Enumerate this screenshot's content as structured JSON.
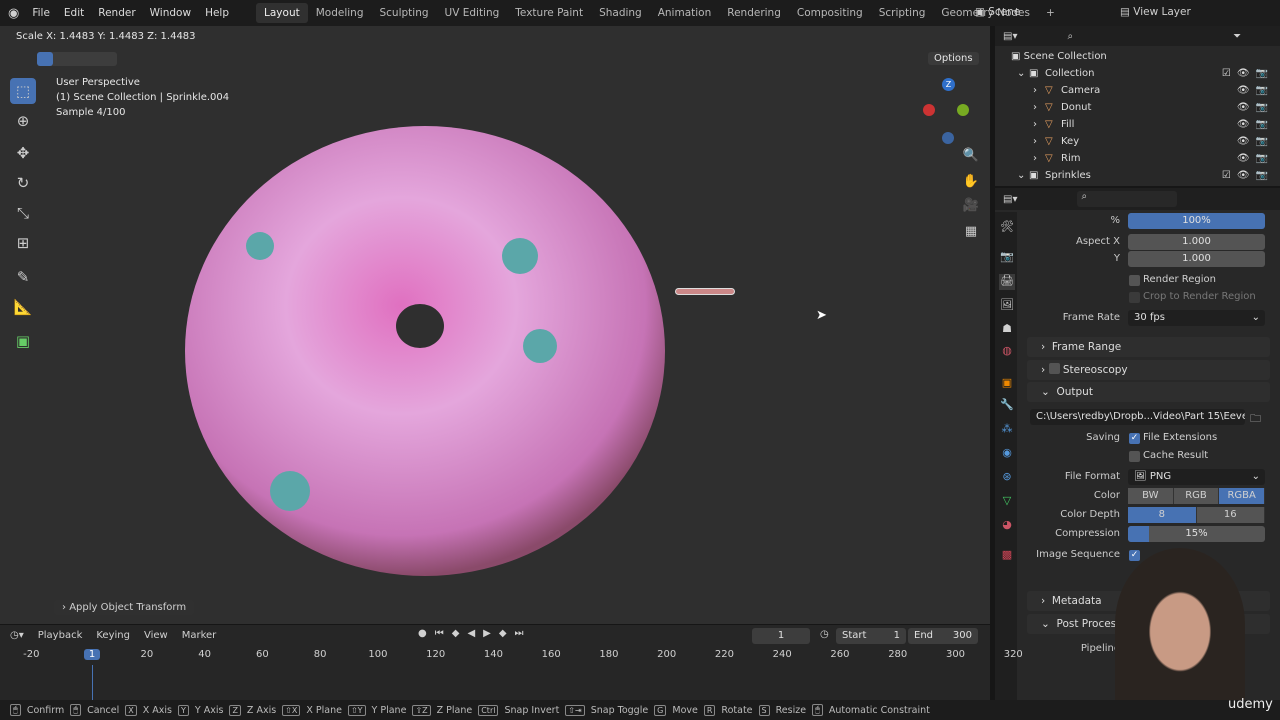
{
  "topbar": {
    "menus": [
      "File",
      "Edit",
      "Render",
      "Window",
      "Help"
    ],
    "workspaces": [
      "Layout",
      "Modeling",
      "Sculpting",
      "UV Editing",
      "Texture Paint",
      "Shading",
      "Animation",
      "Rendering",
      "Compositing",
      "Scripting",
      "Geometry Nodes"
    ],
    "active_workspace": "Layout",
    "scene": "Scene",
    "view_layer": "View Layer",
    "add_tab": "+"
  },
  "viewport": {
    "header_status": "Scale X: 1.4483   Y: 1.4483   Z: 1.4483",
    "view_name": "User Perspective",
    "collection_info": "(1) Scene Collection | Sprinkle.004",
    "sample": "Sample 4/100",
    "options": "Options",
    "last_op": "Apply Object Transform",
    "gizmo_z": "Z"
  },
  "outliner": {
    "root": "Scene Collection",
    "items": [
      {
        "name": "Collection",
        "level": 0
      },
      {
        "name": "Camera",
        "level": 1
      },
      {
        "name": "Donut",
        "level": 1
      },
      {
        "name": "Fill",
        "level": 1
      },
      {
        "name": "Key",
        "level": 1
      },
      {
        "name": "Rim",
        "level": 1
      },
      {
        "name": "Sprinkles",
        "level": 0
      }
    ]
  },
  "properties": {
    "percent_label": "%",
    "percent": "100%",
    "aspect_x_label": "Aspect X",
    "aspect_x": "1.000",
    "aspect_y_label": "Y",
    "aspect_y": "1.000",
    "render_region": "Render Region",
    "crop_region": "Crop to Render Region",
    "frame_rate_label": "Frame Rate",
    "frame_rate": "30 fps",
    "frame_range": "Frame Range",
    "stereoscopy": "Stereoscopy",
    "output": "Output",
    "output_path": "C:\\Users\\redby\\Dropb...Video\\Part 15\\Eevee\\1\\",
    "saving_label": "Saving",
    "file_extensions": "File Extensions",
    "cache_result": "Cache Result",
    "file_format_label": "File Format",
    "file_format": "PNG",
    "color_label": "Color",
    "color_options": [
      "BW",
      "RGB",
      "RGBA"
    ],
    "color_selected": "RGBA",
    "color_depth_label": "Color Depth",
    "color_depth_options": [
      "8",
      "16"
    ],
    "color_depth_selected": "8",
    "compression_label": "Compression",
    "compression": "15%",
    "compression_value": 15,
    "image_sequence_label": "Image Sequence",
    "metadata": "Metadata",
    "post_processing": "Post Processing",
    "pipeline_label": "Pipeline"
  },
  "timeline": {
    "menus": [
      "Playback",
      "Keying",
      "View",
      "Marker"
    ],
    "current_frame": "1",
    "start_label": "Start",
    "start": "1",
    "end_label": "End",
    "end": "300",
    "ruler": [
      "-20",
      "1",
      "20",
      "40",
      "60",
      "80",
      "100",
      "120",
      "140",
      "160",
      "180",
      "200",
      "220",
      "240",
      "260",
      "280",
      "300",
      "320"
    ]
  },
  "statusbar": [
    [
      "",
      "Confirm"
    ],
    [
      "",
      "Cancel"
    ],
    [
      "X",
      "X Axis"
    ],
    [
      "Y",
      "Y Axis"
    ],
    [
      "Z",
      "Z Axis"
    ],
    [
      "⇧X",
      "X Plane"
    ],
    [
      "⇧Y",
      "Y Plane"
    ],
    [
      "⇧Z",
      "Z Plane"
    ],
    [
      "Ctrl",
      "Snap Invert"
    ],
    [
      "⇧⇥",
      "Snap Toggle"
    ],
    [
      "G",
      "Move"
    ],
    [
      "R",
      "Rotate"
    ],
    [
      "S",
      "Resize"
    ],
    [
      "",
      "Automatic Constraint"
    ]
  ],
  "watermark": "udemy",
  "colors": {
    "accent": "#4772b3",
    "donut": "#d77fc9"
  }
}
